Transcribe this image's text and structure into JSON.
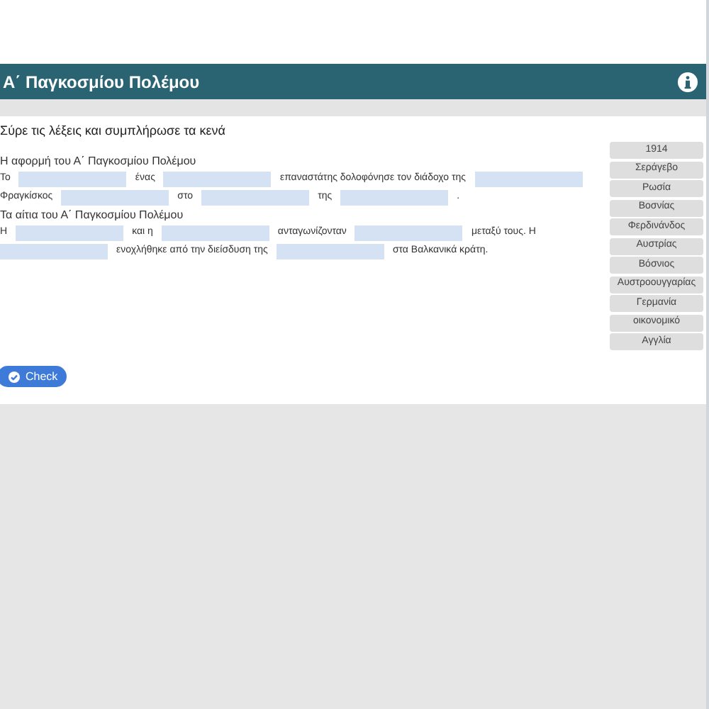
{
  "header": {
    "title": "Α΄ Παγκοσμίου Πολέμου"
  },
  "instruction": "Σύρε τις λέξεις και συμπλήρωσε τα κενά",
  "sections": [
    {
      "heading": "Η αφορμή του Α΄ Παγκοσμίου Πολέμου",
      "lines": [
        [
          {
            "kind": "text",
            "text": "Το"
          },
          {
            "kind": "blank"
          },
          {
            "kind": "text",
            "text": "ένας"
          },
          {
            "kind": "blank"
          },
          {
            "kind": "text",
            "text": "επαναστάτης δολοφόνησε τον διάδοχο της"
          },
          {
            "kind": "blank"
          }
        ],
        [
          {
            "kind": "text",
            "text": "Φραγκίσκος"
          },
          {
            "kind": "blank"
          },
          {
            "kind": "text",
            "text": "στο"
          },
          {
            "kind": "blank"
          },
          {
            "kind": "text",
            "text": "της"
          },
          {
            "kind": "blank"
          },
          {
            "kind": "text",
            "text": "."
          }
        ]
      ]
    },
    {
      "heading": "Τα αίτια του Α΄ Παγκοσμίου Πολέμου",
      "lines": [
        [
          {
            "kind": "text",
            "text": "Η"
          },
          {
            "kind": "blank"
          },
          {
            "kind": "text",
            "text": "και η"
          },
          {
            "kind": "blank"
          },
          {
            "kind": "text",
            "text": "ανταγωνίζονταν"
          },
          {
            "kind": "blank"
          },
          {
            "kind": "text",
            "text": "μεταξύ τους. Η"
          }
        ],
        [
          {
            "kind": "blank"
          },
          {
            "kind": "text",
            "text": "ενοχλήθηκε από την διείσδυση της"
          },
          {
            "kind": "blank"
          },
          {
            "kind": "text",
            "text": "στα Βαλκανικά κράτη."
          }
        ]
      ]
    }
  ],
  "word_bank": [
    "1914",
    "Σεράγεβο",
    "Ρωσία",
    "Βοσνίας",
    "Φερδινάνδος",
    "Αυστρίας",
    "Βόσνιος",
    "Αυστροουγγαρίας",
    "Γερμανία",
    "οικονομικό",
    "Αγγλία"
  ],
  "check_button": "Check"
}
